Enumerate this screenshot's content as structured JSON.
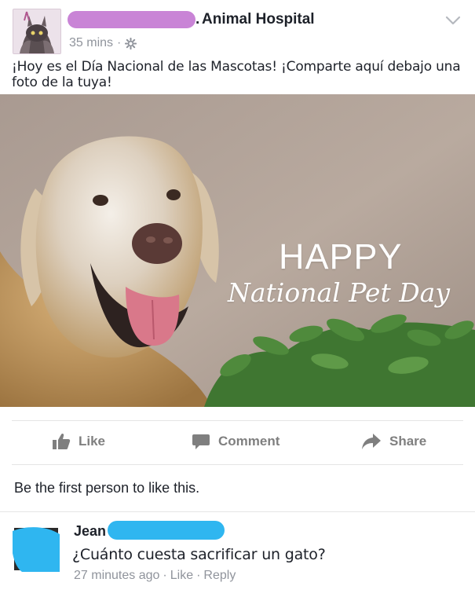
{
  "post": {
    "page_name_suffix": "Animal Hospital",
    "timestamp": "35 mins",
    "separator": "·",
    "privacy_icon": "gear-icon",
    "text": "¡Hoy es el Día Nacional de las Mascotas! ¡Comparte aquí debajo una foto de la tuya!",
    "image": {
      "caption_line1": "HAPPY",
      "caption_line2": "National Pet Day"
    }
  },
  "actions": {
    "like_label": "Like",
    "comment_label": "Comment",
    "share_label": "Share"
  },
  "likes_text": "Be the first person to like this.",
  "comment": {
    "author_visible": "Jean",
    "text": "¿Cuánto cuesta sacrificar un gato?",
    "time": "27 minutes ago",
    "sep": "·",
    "like_label": "Like",
    "reply_label": "Reply"
  },
  "colors": {
    "redaction_pink": "#c984d6",
    "redaction_blue": "#2fb6f0",
    "meta_gray": "#90949c",
    "action_gray": "#7f7f7f"
  }
}
